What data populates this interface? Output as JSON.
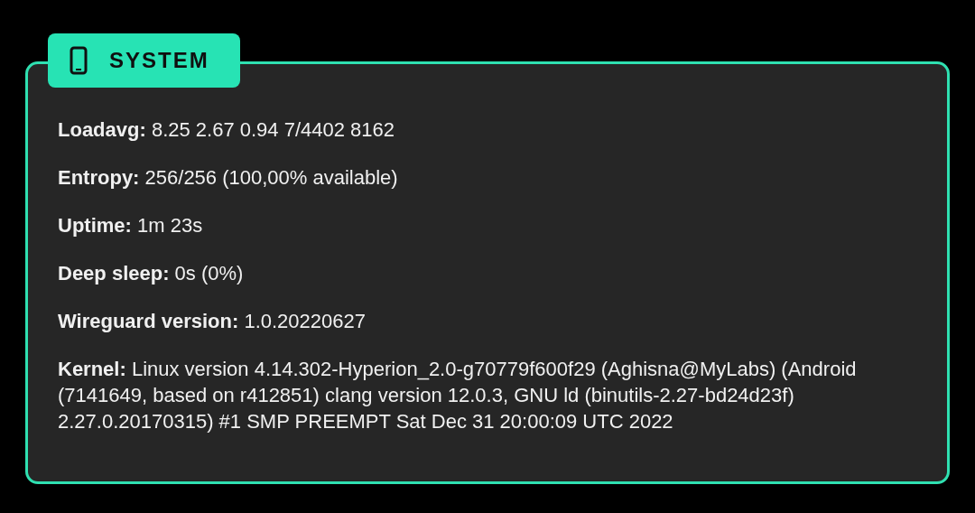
{
  "section": {
    "title": "SYSTEM"
  },
  "lines": [
    "**Loadavg:** 8.25 2.67 0.94 7/4402 8162",
    "**Entropy:** 256/256 (100,00% available)",
    "**Uptime:** 1m 23s",
    "**Deep sleep:** 0s (0%)",
    "**Wireguard version:** 1.0.20220627",
    "**Kernel:** Linux version 4.14.302-Hyperion_2.0-g70779f600f29 (Aghisna@MyLabs) (Android (7141649, based on r412851) clang version 12.0.3, GNU ld (binutils-2.27-bd24d23f) 2.27.0.20170315) #1 SMP PREEMPT Sat Dec 31 20:00:09 UTC 2022"
  ]
}
